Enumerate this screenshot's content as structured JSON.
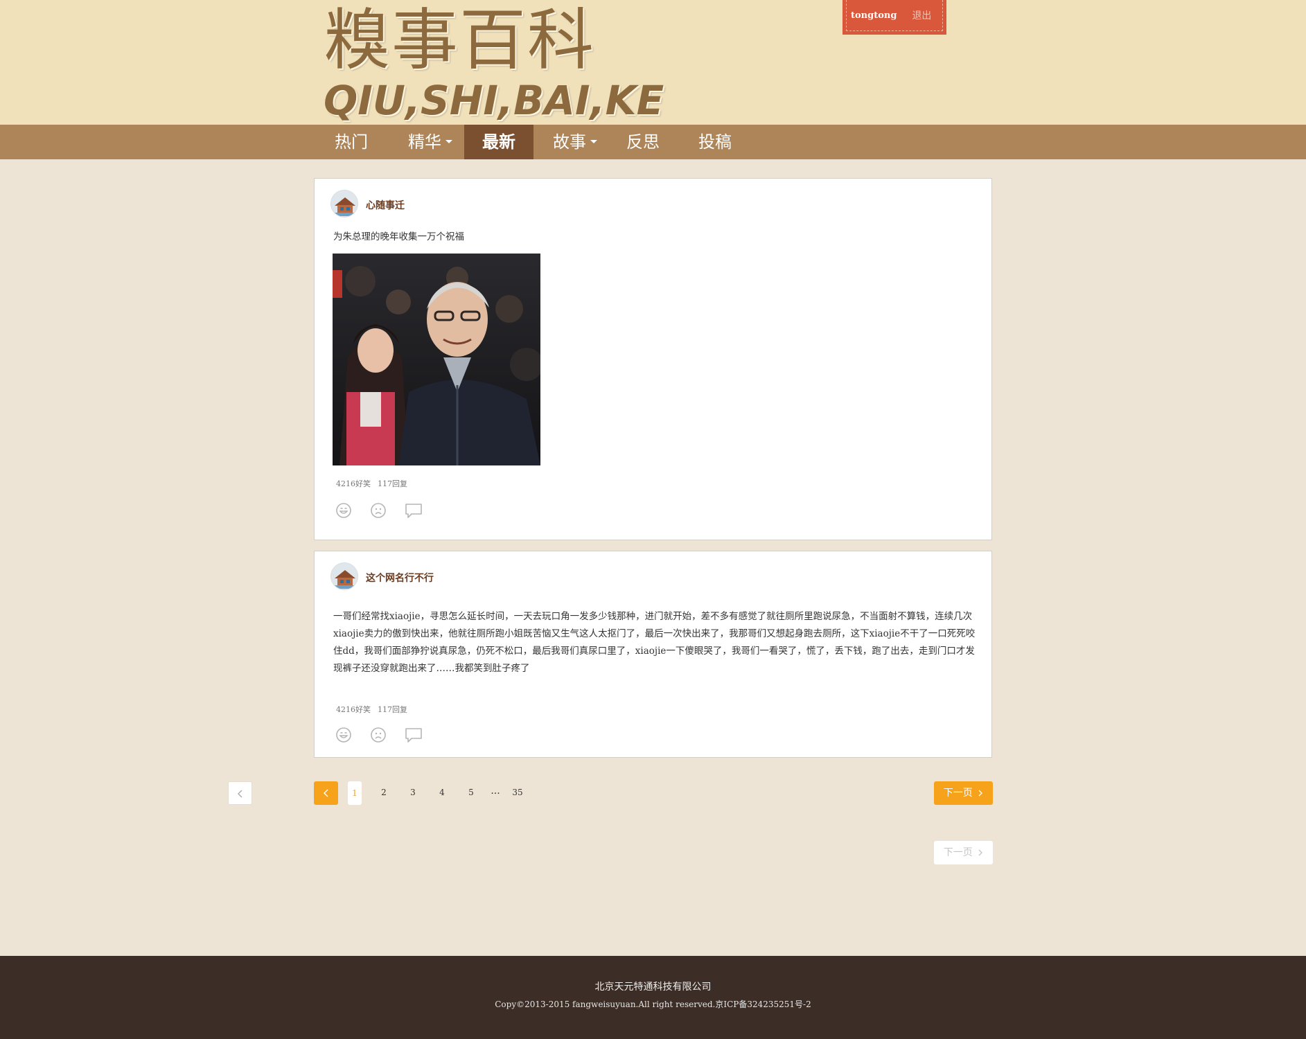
{
  "header": {
    "logo_cn": "糗事百科",
    "logo_en": "QIU,SHI,BAI,KE",
    "username": "tongtong",
    "logout": "退出"
  },
  "nav": {
    "items": [
      {
        "label": "热门",
        "has_dropdown": false,
        "active": false
      },
      {
        "label": "精华",
        "has_dropdown": true,
        "active": false
      },
      {
        "label": "最新",
        "has_dropdown": false,
        "active": true
      },
      {
        "label": "故事",
        "has_dropdown": true,
        "active": false
      },
      {
        "label": "反思",
        "has_dropdown": false,
        "active": false
      },
      {
        "label": "投稿",
        "has_dropdown": false,
        "active": false
      }
    ]
  },
  "posts": [
    {
      "author": "心随事迁",
      "text": "为朱总理的晚年收集一万个祝福",
      "funny": "4216好笑",
      "replies": "117回复",
      "has_image": true
    },
    {
      "author": "这个网名行不行",
      "text": "一哥们经常找xiaojie，寻思怎么延长时间，一天去玩口角一发多少钱那种，进门就开始，差不多有感觉了就往厕所里跑说尿急，不当面射不算钱，连续几次xiaojie卖力的傲到快出来，他就往厕所跑小姐既苦恼又生气这人太抠门了，最后一次快出来了，我那哥们又想起身跑去厕所，这下xiaojie不干了一口死死咬住dd，我哥们面部狰狞说真尿急，仍死不松口，最后我哥们真尿口里了，xiaojie一下傻眼哭了，我哥们一看哭了，慌了，丢下钱，跑了出去，走到门口才发现裤子还没穿就跑出来了……我都笑到肚子疼了",
      "funny": "4216好笑",
      "replies": "117回复",
      "has_image": false
    }
  ],
  "pagination": {
    "pages": [
      "1",
      "2",
      "3",
      "4",
      "5"
    ],
    "ellipsis": "...",
    "last": "35",
    "current": "1",
    "next_label": "下一页",
    "next_label_2": "下一页",
    "prev_icon": "chevron-left-icon",
    "next_icon": "chevron-right-icon"
  },
  "footer": {
    "company": "北京天元特通科技有限公司",
    "copyright": "Copy©2013-2015 fangweisuyuan.All right reserved.京ICP备324235251号-2"
  },
  "colors": {
    "header_bg": "#f1e1bb",
    "nav_bg": "#ad8559",
    "nav_active": "#7b5030",
    "accent_orange": "#f7a21b",
    "user_box": "#d9573b",
    "footer_bg": "#3c2e26"
  }
}
